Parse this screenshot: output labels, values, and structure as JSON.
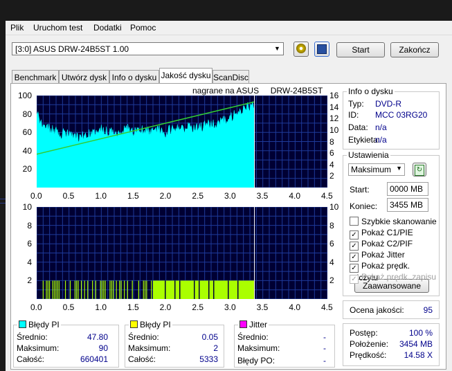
{
  "menu": [
    "Plik",
    "Uruchom test",
    "Dodatki",
    "Pomoc"
  ],
  "drive": {
    "selected": "[3:0]   ASUS DRW-24B5ST 1.00"
  },
  "buttons": {
    "start": "Start",
    "exit": "Zakończ"
  },
  "tabs": [
    {
      "label": "Benchmark"
    },
    {
      "label": "Utwórz dysk"
    },
    {
      "label": "Info o dysku"
    },
    {
      "label": "Jakość dysku"
    },
    {
      "label": "ScanDisc"
    }
  ],
  "chart_header": "nagrane na ASUS     DRW-24B5ST",
  "colors": {
    "pi_fill": "#00ffff",
    "pif_fill": "#aaff00",
    "speed_line": "#32cd32",
    "plot_bg": "#000033",
    "grid": "#1e3a9a",
    "position_marker": "#ffffff",
    "pi_swatch": "#00ffff",
    "pif_swatch": "#ffff00",
    "jitter_swatch": "#ff00ff"
  },
  "chart_data": [
    {
      "type": "area",
      "x_ticks": [
        "0.0",
        "0.5",
        "1.0",
        "1.5",
        "2.0",
        "2.5",
        "3.0",
        "3.5",
        "4.0",
        "4.5"
      ],
      "y_left_ticks": [
        "100",
        "80",
        "60",
        "40",
        "20"
      ],
      "y_right_ticks": [
        "16",
        "14",
        "12",
        "10",
        "8",
        "6",
        "4",
        "2"
      ],
      "xlim": [
        0,
        4.5
      ],
      "ylim": [
        0,
        100
      ],
      "y2lim": [
        0,
        16
      ],
      "series": [
        {
          "x": [
            0.0,
            0.05,
            0.1,
            0.2,
            0.3,
            0.4,
            0.5,
            0.6,
            0.7,
            0.8,
            0.9,
            1.0,
            1.1,
            1.2,
            1.3,
            1.4,
            1.5,
            1.6,
            1.7,
            1.8,
            1.9,
            2.0,
            2.1,
            2.2,
            2.3,
            2.4,
            2.5,
            2.6,
            2.7,
            2.8,
            2.9,
            3.0,
            3.1,
            3.2,
            3.3,
            3.37
          ],
          "values": [
            85,
            70,
            63,
            61,
            58,
            56,
            55,
            52,
            53,
            55,
            60,
            62,
            58,
            56,
            60,
            62,
            57,
            60,
            58,
            58,
            60,
            57,
            62,
            60,
            62,
            63,
            62,
            65,
            66,
            68,
            70,
            74,
            78,
            82,
            85,
            86
          ]
        },
        {
          "x": [
            0.0,
            3.37
          ],
          "values": [
            5.8,
            14.9
          ]
        }
      ],
      "position_marker_x": 3.37
    },
    {
      "type": "bar",
      "x_ticks": [
        "0.0",
        "0.5",
        "1.0",
        "1.5",
        "2.0",
        "2.5",
        "3.0",
        "3.5",
        "4.0",
        "4.5"
      ],
      "y_left_ticks": [
        "10",
        "8",
        "6",
        "4",
        "2"
      ],
      "y_right_ticks": [
        "10",
        "8",
        "6",
        "4",
        "2"
      ],
      "xlim": [
        0,
        4.5
      ],
      "ylim": [
        0,
        10
      ],
      "series": [
        {
          "x_ranges": [
            [
              0.02,
              1.8
            ]
          ],
          "value": 2,
          "density": "sparse"
        },
        {
          "x_ranges": [
            [
              1.8,
              3.37
            ]
          ],
          "value": 2,
          "density": "dense"
        }
      ],
      "position_marker_x": 3.37
    }
  ],
  "info": {
    "title": "Info o dysku",
    "type_label": "Typ:",
    "type_value": "DVD-R",
    "id_label": "ID:",
    "id_value": "MCC 03RG20",
    "date_label": "Data:",
    "date_value": "n/a",
    "tag_label": "Etykieta:",
    "tag_value": "n/a"
  },
  "settings": {
    "title": "Ustawienia",
    "speed": "Maksimum",
    "start_label": "Start:",
    "start_value": "0000 MB",
    "end_label": "Koniec:",
    "end_value": "3455 MB",
    "checks": [
      {
        "label": "Szybkie skanowanie",
        "checked": false,
        "disabled": false
      },
      {
        "label": "Pokaż C1/PIE",
        "checked": true,
        "disabled": false
      },
      {
        "label": "Pokaż C2/PIF",
        "checked": true,
        "disabled": false
      },
      {
        "label": "Pokaż Jitter",
        "checked": true,
        "disabled": false
      },
      {
        "label": "Pokaż prędk. odczytu",
        "checked": true,
        "disabled": false
      },
      {
        "label": "Pokaż prędk. zapisu",
        "checked": true,
        "disabled": true
      }
    ],
    "advanced": "Zaawansowane"
  },
  "quality": {
    "label": "Ocena jakości:",
    "value": "95"
  },
  "progress": {
    "progress_label": "Postęp:",
    "progress_value": "100 %",
    "position_label": "Położenie:",
    "position_value": "3454 MB",
    "speed_label": "Prędkość:",
    "speed_value": "14.58 X"
  },
  "stats": {
    "pi": {
      "title": "Błędy PI",
      "avg_label": "Średnio:",
      "avg": "47.80",
      "max_label": "Maksimum:",
      "max": "90",
      "total_label": "Całość:",
      "total": "660401"
    },
    "pif": {
      "title": "Błędy PI",
      "avg_label": "Średnio:",
      "avg": "0.05",
      "max_label": "Maksimum:",
      "max": "2",
      "total_label": "Całość:",
      "total": "5333"
    },
    "jitter": {
      "title": "Jitter",
      "avg_label": "Średnio:",
      "avg": "-",
      "max_label": "Maksimum:",
      "max": "-",
      "po_label": "Błędy PO:",
      "po": "-"
    }
  }
}
